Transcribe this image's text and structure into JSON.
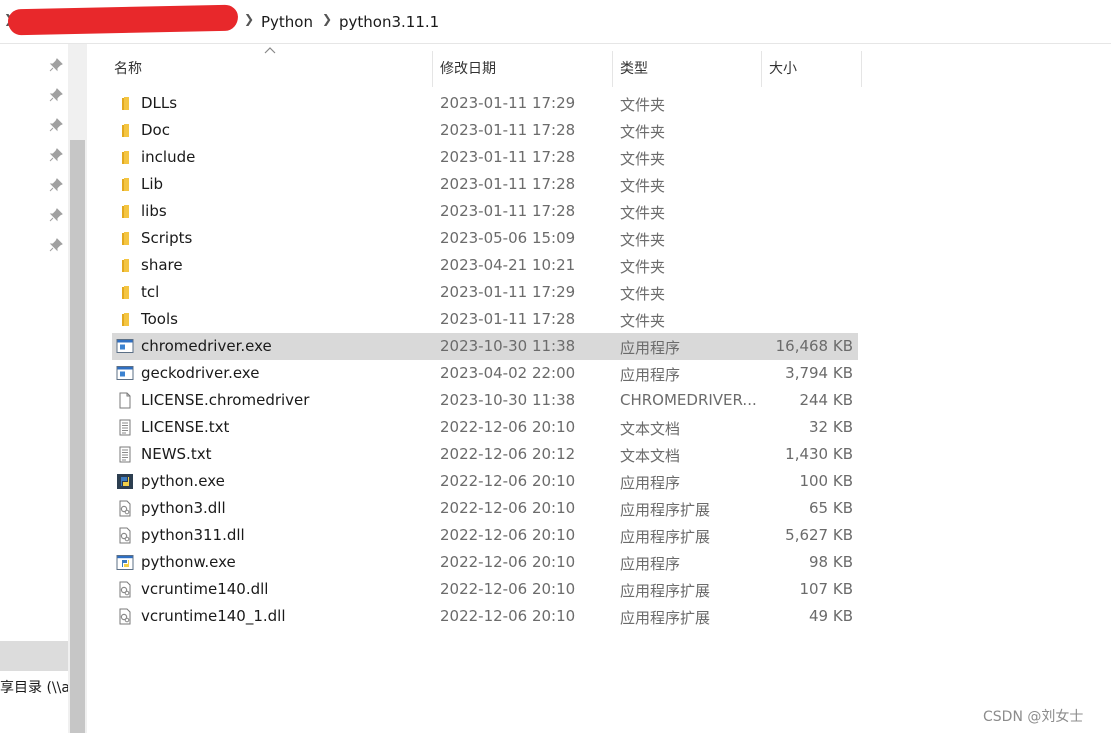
{
  "breadcrumb": {
    "items": [
      "Python",
      "python3.11.1"
    ]
  },
  "columns": {
    "name": "名称",
    "date": "修改日期",
    "type": "类型",
    "size": "大小"
  },
  "files": [
    {
      "name": "DLLs",
      "date": "2023-01-11 17:29",
      "type": "文件夹",
      "size": "",
      "icon": "folder-icon"
    },
    {
      "name": "Doc",
      "date": "2023-01-11 17:28",
      "type": "文件夹",
      "size": "",
      "icon": "folder-icon"
    },
    {
      "name": "include",
      "date": "2023-01-11 17:28",
      "type": "文件夹",
      "size": "",
      "icon": "folder-icon"
    },
    {
      "name": "Lib",
      "date": "2023-01-11 17:28",
      "type": "文件夹",
      "size": "",
      "icon": "folder-icon"
    },
    {
      "name": "libs",
      "date": "2023-01-11 17:28",
      "type": "文件夹",
      "size": "",
      "icon": "folder-icon"
    },
    {
      "name": "Scripts",
      "date": "2023-05-06 15:09",
      "type": "文件夹",
      "size": "",
      "icon": "folder-icon"
    },
    {
      "name": "share",
      "date": "2023-04-21 10:21",
      "type": "文件夹",
      "size": "",
      "icon": "folder-icon"
    },
    {
      "name": "tcl",
      "date": "2023-01-11 17:29",
      "type": "文件夹",
      "size": "",
      "icon": "folder-icon"
    },
    {
      "name": "Tools",
      "date": "2023-01-11 17:28",
      "type": "文件夹",
      "size": "",
      "icon": "folder-icon"
    },
    {
      "name": "chromedriver.exe",
      "date": "2023-10-30 11:38",
      "type": "应用程序",
      "size": "16,468 KB",
      "icon": "exe-icon",
      "selected": true
    },
    {
      "name": "geckodriver.exe",
      "date": "2023-04-02 22:00",
      "type": "应用程序",
      "size": "3,794 KB",
      "icon": "exe-icon"
    },
    {
      "name": "LICENSE.chromedriver",
      "date": "2023-10-30 11:38",
      "type": "CHROMEDRIVER...",
      "size": "244 KB",
      "icon": "file-icon"
    },
    {
      "name": "LICENSE.txt",
      "date": "2022-12-06 20:10",
      "type": "文本文档",
      "size": "32 KB",
      "icon": "text-file-icon"
    },
    {
      "name": "NEWS.txt",
      "date": "2022-12-06 20:12",
      "type": "文本文档",
      "size": "1,430 KB",
      "icon": "text-file-icon"
    },
    {
      "name": "python.exe",
      "date": "2022-12-06 20:10",
      "type": "应用程序",
      "size": "100 KB",
      "icon": "python-exe-icon"
    },
    {
      "name": "python3.dll",
      "date": "2022-12-06 20:10",
      "type": "应用程序扩展",
      "size": "65 KB",
      "icon": "dll-icon"
    },
    {
      "name": "python311.dll",
      "date": "2022-12-06 20:10",
      "type": "应用程序扩展",
      "size": "5,627 KB",
      "icon": "dll-icon"
    },
    {
      "name": "pythonw.exe",
      "date": "2022-12-06 20:10",
      "type": "应用程序",
      "size": "98 KB",
      "icon": "pythonw-exe-icon"
    },
    {
      "name": "vcruntime140.dll",
      "date": "2022-12-06 20:10",
      "type": "应用程序扩展",
      "size": "107 KB",
      "icon": "dll-icon"
    },
    {
      "name": "vcruntime140_1.dll",
      "date": "2022-12-06 20:10",
      "type": "应用程序扩展",
      "size": "49 KB",
      "icon": "dll-icon"
    }
  ],
  "navpane": {
    "partial_item": "享目录 (\\\\a"
  },
  "watermark": "CSDN @刘女士",
  "colors": {
    "selected_row": "#d9d9d9",
    "folder": "#f4c542",
    "redaction": "#e8282b"
  }
}
